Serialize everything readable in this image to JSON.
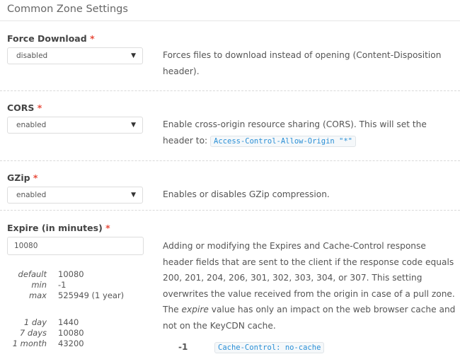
{
  "header": {
    "title": "Common Zone Settings"
  },
  "required_marker": "*",
  "settings": {
    "force_download": {
      "label": "Force Download",
      "value": "disabled",
      "description": "Forces files to download instead of opening (Content-Disposition header)."
    },
    "cors": {
      "label": "CORS",
      "value": "enabled",
      "description_prefix": "Enable cross-origin resource sharing (CORS). This will set the header to:",
      "code": "Access-Control-Allow-Origin \"*\""
    },
    "gzip": {
      "label": "GZip",
      "value": "enabled",
      "description": "Enables or disables GZip compression."
    },
    "expire": {
      "label": "Expire (in minutes)",
      "value": "10080",
      "description_part1": "Adding or modifying the Expires and Cache-Control response header fields that are sent to the client if the response code equals 200, 201, 204, 206, 301, 302, 303, 304, or 307. This setting overwrites the value received from the origin in case of a pull zone. The ",
      "description_em": "expire",
      "description_part2": " value has only an impact on the web browser cache and not on the KeyCDN cache.",
      "limits": [
        {
          "key": "default",
          "value": "10080"
        },
        {
          "key": "min",
          "value": "-1"
        },
        {
          "key": "max",
          "value": "525949 (1 year)"
        }
      ],
      "presets": [
        {
          "key": "1 day",
          "value": "1440"
        },
        {
          "key": "7 days",
          "value": "10080"
        },
        {
          "key": "1 month",
          "value": "43200"
        }
      ],
      "code_examples": [
        {
          "value": "-1",
          "code": "Cache-Control: no-cache"
        }
      ]
    }
  },
  "colors": {
    "required": "#e74c3c",
    "code_text": "#2a8fd6"
  }
}
